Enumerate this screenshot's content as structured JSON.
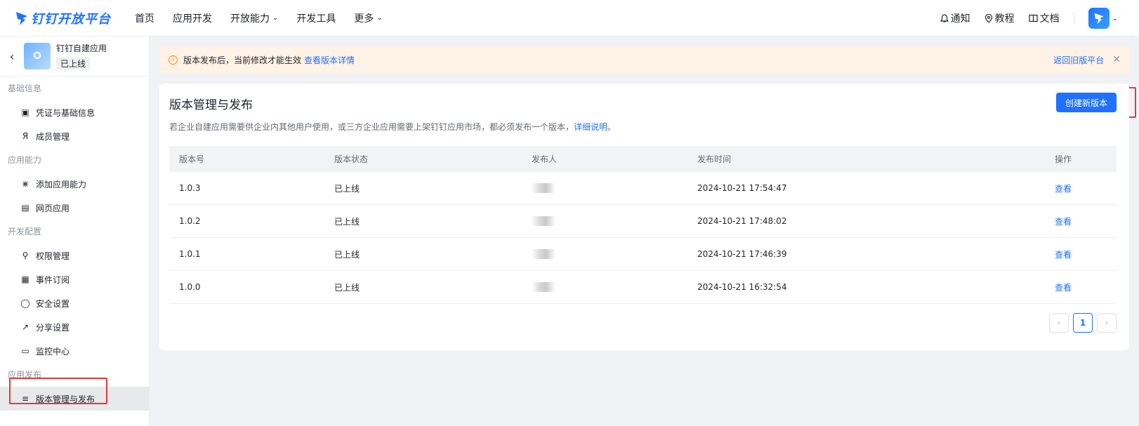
{
  "brand": {
    "name": "钉钉开放平台"
  },
  "nav": {
    "items": [
      {
        "label": "首页",
        "has_menu": false
      },
      {
        "label": "应用开发",
        "has_menu": false
      },
      {
        "label": "开放能力",
        "has_menu": true
      },
      {
        "label": "开发工具",
        "has_menu": false
      },
      {
        "label": "更多",
        "has_menu": true
      }
    ]
  },
  "top_right": {
    "notify": "通知",
    "tutorial": "教程",
    "docs": "文档"
  },
  "sidebar": {
    "app": {
      "name": "钉钉自建应用",
      "status": "已上线"
    },
    "groups": [
      {
        "title": "基础信息",
        "items": [
          {
            "label": "凭证与基础信息",
            "icon": "credential-icon"
          },
          {
            "label": "成员管理",
            "icon": "member-icon"
          }
        ]
      },
      {
        "title": "应用能力",
        "items": [
          {
            "label": "添加应用能力",
            "icon": "apps-icon"
          },
          {
            "label": "网页应用",
            "icon": "webpage-icon"
          }
        ]
      },
      {
        "title": "开发配置",
        "items": [
          {
            "label": "权限管理",
            "icon": "permission-icon"
          },
          {
            "label": "事件订阅",
            "icon": "event-icon"
          },
          {
            "label": "安全设置",
            "icon": "shield-icon"
          },
          {
            "label": "分享设置",
            "icon": "share-icon"
          },
          {
            "label": "监控中心",
            "icon": "monitor-icon"
          }
        ]
      },
      {
        "title": "应用发布",
        "items": [
          {
            "label": "版本管理与发布",
            "icon": "layers-icon",
            "active": true
          }
        ]
      }
    ]
  },
  "notice": {
    "text": "版本发布后，当前修改才能生效",
    "link": "查看版本详情",
    "back_label": "返回旧版平台"
  },
  "main": {
    "title": "版本管理与发布",
    "desc": "若企业自建应用需要供企业内其他用户使用，或三方企业应用需要上架钉钉应用市场，都必须发布一个版本，",
    "desc_link": "详细说明",
    "desc_end": "。",
    "create_button": "创建新版本"
  },
  "table": {
    "headers": [
      "版本号",
      "版本状态",
      "发布人",
      "发布时间",
      "操作"
    ],
    "rows": [
      {
        "version": "1.0.3",
        "status": "已上线",
        "time": "2024-10-21 17:54:47",
        "action": "查看"
      },
      {
        "version": "1.0.2",
        "status": "已上线",
        "time": "2024-10-21 17:48:02",
        "action": "查看"
      },
      {
        "version": "1.0.1",
        "status": "已上线",
        "time": "2024-10-21 17:46:39",
        "action": "查看"
      },
      {
        "version": "1.0.0",
        "status": "已上线",
        "time": "2024-10-21 16:32:54",
        "action": "查看"
      }
    ]
  },
  "pagination": {
    "current": "1"
  },
  "colors": {
    "primary": "#1f71ff",
    "notice_bg": "#fff2e6",
    "warning": "#ff8800",
    "highlight": "#e53935"
  }
}
